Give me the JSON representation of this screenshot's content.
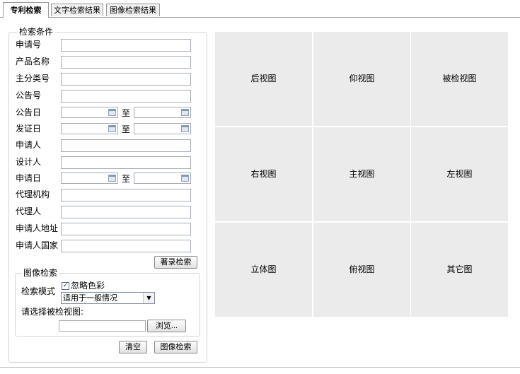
{
  "tabs": [
    {
      "label": "专利检索",
      "active": true
    },
    {
      "label": "文字检索结果",
      "active": false
    },
    {
      "label": "图像检索结果",
      "active": false
    }
  ],
  "search_conditions": {
    "legend": "检索条件",
    "fields": {
      "application_no": {
        "label": "申请号",
        "value": ""
      },
      "product_name": {
        "label": "产品名称",
        "value": ""
      },
      "main_class_no": {
        "label": "主分类号",
        "value": ""
      },
      "announcement_no": {
        "label": "公告号",
        "value": ""
      },
      "announcement_date": {
        "label": "公告日",
        "from": "",
        "to": ""
      },
      "certificate_date": {
        "label": "发证日",
        "from": "",
        "to": ""
      },
      "applicant": {
        "label": "申请人",
        "value": ""
      },
      "designer": {
        "label": "设计人",
        "value": ""
      },
      "application_date": {
        "label": "申请日",
        "from": "",
        "to": ""
      },
      "agency": {
        "label": "代理机构",
        "value": ""
      },
      "agent": {
        "label": "代理人",
        "value": ""
      },
      "applicant_address": {
        "label": "申请人地址",
        "value": ""
      },
      "applicant_country": {
        "label": "申请人国家",
        "value": ""
      }
    },
    "range_separator": "至",
    "catalog_search_button": "著录检索"
  },
  "image_search": {
    "legend": "图像检索",
    "mode_label": "检索模式",
    "ignore_color": {
      "label": "忽略色彩",
      "checked": true
    },
    "mode_select": {
      "selected": "适用于一般情况"
    },
    "choose_view_label": "请选择被检视图:",
    "file_path": "",
    "browse_button": "浏览..."
  },
  "actions": {
    "clear_button": "清空",
    "image_search_button": "图像检索"
  },
  "views": [
    {
      "label": "后视图"
    },
    {
      "label": "仰视图"
    },
    {
      "label": "被检视图"
    },
    {
      "label": "右视图"
    },
    {
      "label": "主视图"
    },
    {
      "label": "左视图"
    },
    {
      "label": "立体图"
    },
    {
      "label": "俯视图"
    },
    {
      "label": "其它图"
    }
  ],
  "icons": {
    "calendar": "calendar-icon",
    "dropdown": "chevron-down-icon",
    "checkbox_mark": "✓",
    "arrow_glyph": "▼"
  }
}
